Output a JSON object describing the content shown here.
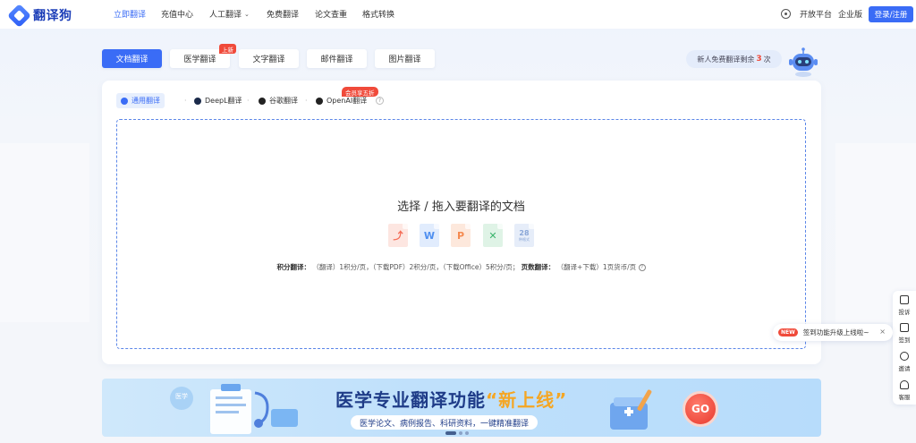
{
  "brand": {
    "name": "翻译狗"
  },
  "nav": {
    "items": [
      {
        "label": "立即翻译",
        "active": true
      },
      {
        "label": "充值中心"
      },
      {
        "label": "人工翻译",
        "has_dropdown": true
      },
      {
        "label": "免费翻译"
      },
      {
        "label": "论文查重"
      },
      {
        "label": "格式转换"
      }
    ],
    "open_platform": "开放平台",
    "enterprise": "企业版",
    "login": "登录/注册"
  },
  "tabs": [
    {
      "label": "文档翻译",
      "active": true
    },
    {
      "label": "医学翻译",
      "badge": "上新"
    },
    {
      "label": "文字翻译"
    },
    {
      "label": "邮件翻译"
    },
    {
      "label": "图片翻译"
    }
  ],
  "free_notice": {
    "prefix": "新人免费翻译剩余",
    "count": "3",
    "suffix": "次"
  },
  "engines": {
    "items": [
      {
        "label": "通用翻译",
        "active": true
      },
      {
        "label": "DeepL翻译"
      },
      {
        "label": "谷歌翻译"
      },
      {
        "label": "OpenAI翻译",
        "badge": "会员享五折"
      }
    ]
  },
  "dropzone": {
    "title": "选择 / 拖入要翻译的文档",
    "file_types": [
      {
        "icon": "pdf-icon",
        "glyph": "⤴",
        "color": "#f46a54"
      },
      {
        "icon": "word-icon",
        "glyph": "W",
        "color": "#4e8ff0"
      },
      {
        "icon": "ppt-icon",
        "glyph": "P",
        "color": "#f58a50"
      },
      {
        "icon": "excel-icon",
        "glyph": "✕",
        "color": "#39b36b"
      },
      {
        "icon": "more-formats-icon",
        "glyph": "28",
        "sub": "种格式",
        "color": "#8aa7d8"
      }
    ],
    "credit": {
      "label1": "积分翻译：",
      "text1": "（翻译）1积分/页，（下载PDF）2积分/页，（下载Office）5积分/页；",
      "label2": "页数翻译：",
      "text2": "（翻译+下载）1页货币/页"
    }
  },
  "banner": {
    "title_prefix": "医学专业翻译功能",
    "title_highlight": "“新上线”",
    "subtitle": "医学论文、病例报告、科研资料，一键精准翻译",
    "go": "GO",
    "deco_label": "医学"
  },
  "sidebar": {
    "items": [
      {
        "label": "投诉",
        "icon": "complaint-icon"
      },
      {
        "label": "签到",
        "icon": "checkin-icon"
      },
      {
        "label": "邀请",
        "icon": "invite-icon"
      },
      {
        "label": "客服",
        "icon": "service-icon"
      }
    ]
  },
  "toast": {
    "badge": "NEW",
    "text": "签到功能升级上线啦~",
    "close": "×"
  },
  "colors": {
    "primary": "#3a6cf6",
    "badge": "#f04a3a",
    "banner_title": "#1f3c88"
  }
}
